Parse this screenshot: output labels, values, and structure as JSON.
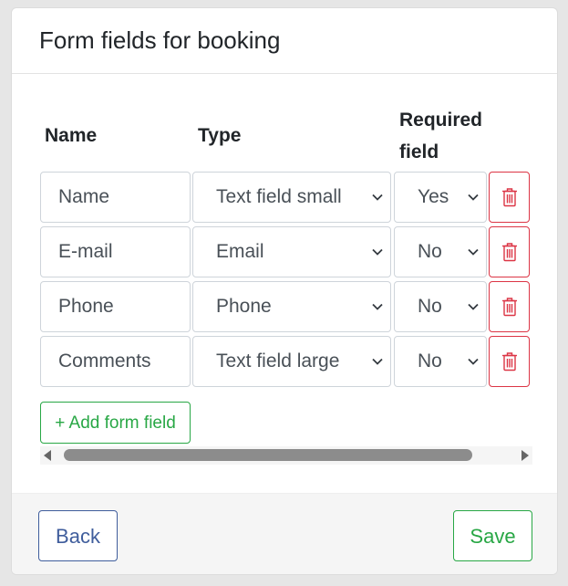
{
  "card": {
    "title": "Form fields for booking"
  },
  "table": {
    "headers": {
      "name": "Name",
      "type": "Type",
      "required": "Required field"
    },
    "rows": [
      {
        "name": "Name",
        "type": "Text field small",
        "required": "Yes"
      },
      {
        "name": "E-mail",
        "type": "Email",
        "required": "No"
      },
      {
        "name": "Phone",
        "type": "Phone",
        "required": "No"
      },
      {
        "name": "Comments",
        "type": "Text field large",
        "required": "No"
      }
    ]
  },
  "actions": {
    "add_label": "+ Add form field",
    "back_label": "Back",
    "save_label": "Save"
  },
  "icons": {
    "delete": "trash-icon",
    "select": "chevron-down-icon",
    "scroll_left": "caret-left-icon",
    "scroll_right": "caret-right-icon"
  },
  "colors": {
    "danger": "#dc3545",
    "success": "#28a745",
    "primary": "#3f5d9c"
  }
}
